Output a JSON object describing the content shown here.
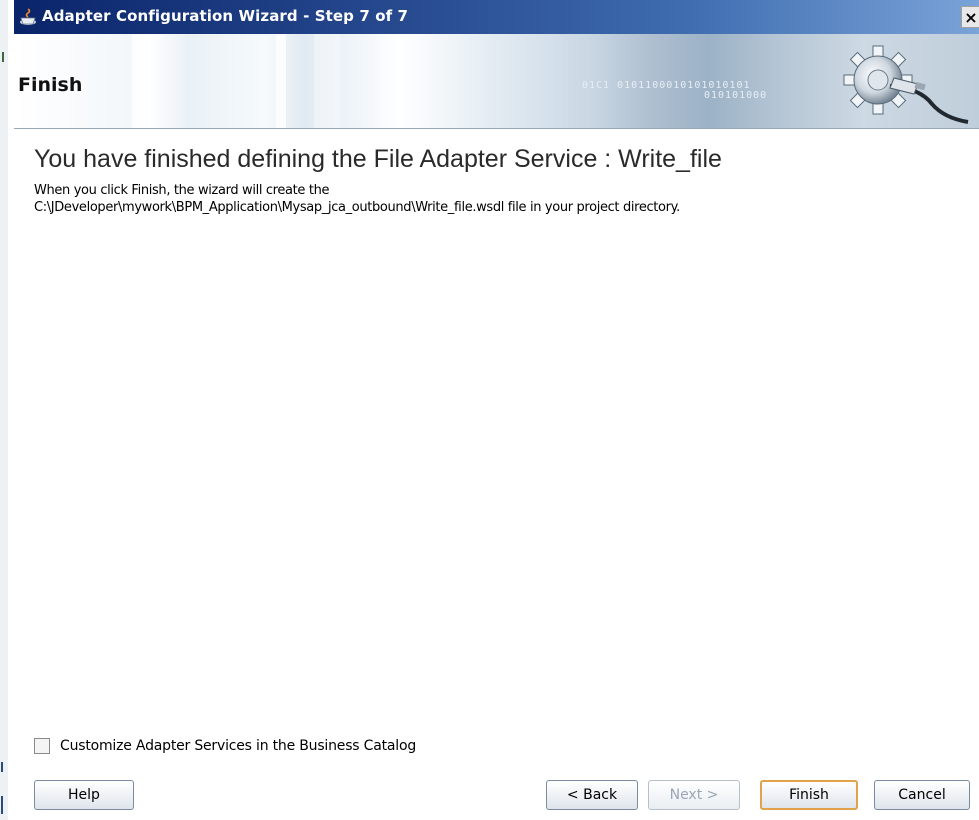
{
  "window": {
    "title": "Adapter Configuration Wizard - Step 7 of 7",
    "close_label": "×"
  },
  "banner": {
    "heading": "Finish",
    "binary_text_1": "01C1 0101100010101010101",
    "binary_text_2": "010101000"
  },
  "content": {
    "title": "You have finished defining the File Adapter Service : Write_file",
    "line1": "When you click Finish, the wizard will create the",
    "line2": "C:\\JDeveloper\\mywork\\BPM_Application\\Mysap_jca_outbound\\Write_file.wsdl file in your project directory."
  },
  "options": {
    "customize_label": "Customize Adapter Services in the Business Catalog",
    "customize_checked": false
  },
  "buttons": {
    "help": "Help",
    "back": "< Back",
    "next": "Next >",
    "finish": "Finish",
    "cancel": "Cancel"
  },
  "colors": {
    "titlebar": "#0a246a",
    "default_button_border": "#e0a24a"
  },
  "icons": {
    "app": "java-cup-icon",
    "banner": "gear-plug-icon"
  }
}
